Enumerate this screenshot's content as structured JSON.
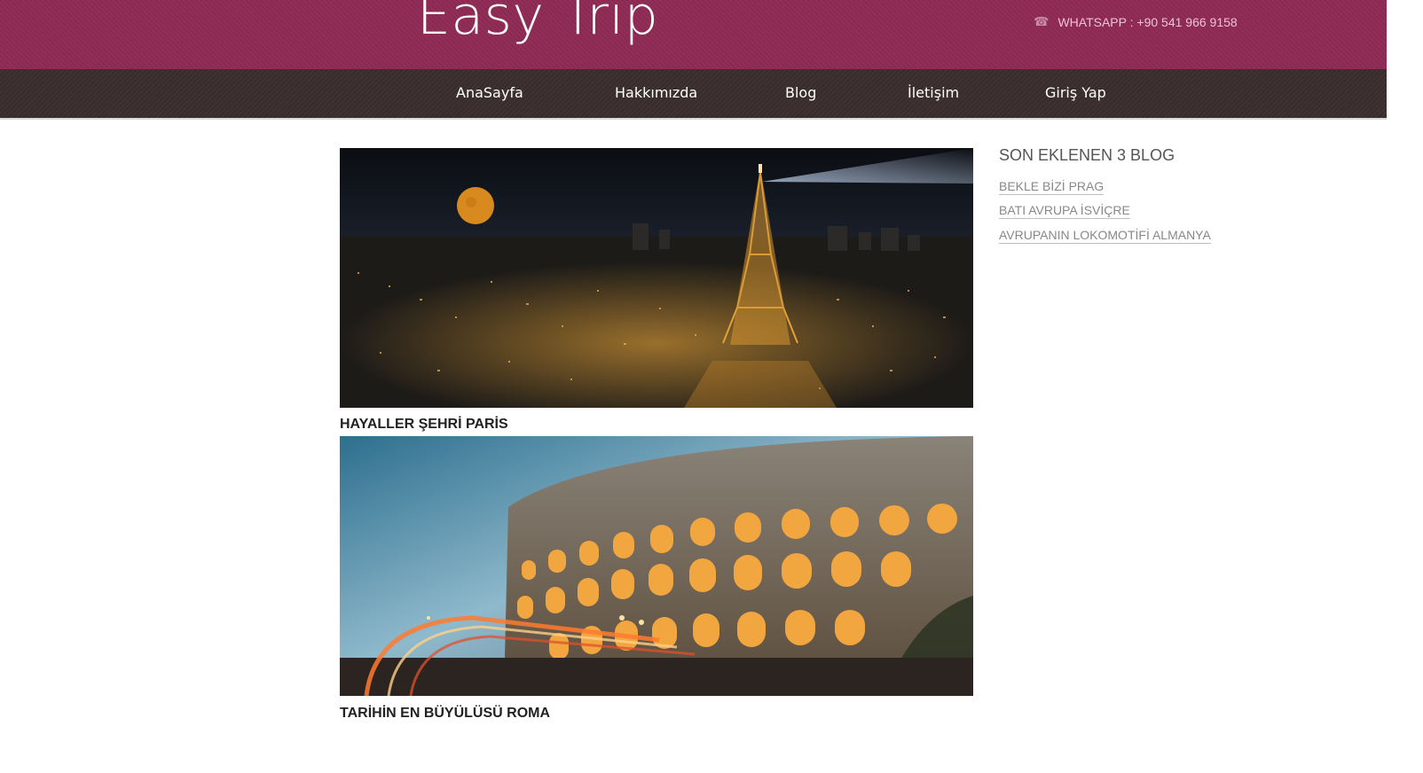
{
  "header": {
    "logo": "Easy Trip",
    "contact_icon": "phone-icon",
    "contact_text": "WHATSAPP : +90 541 966 9158",
    "background_color": "#8e2a55"
  },
  "nav": {
    "background_color": "#3a2c2c",
    "items": [
      {
        "label": "AnaSayfa"
      },
      {
        "label": "Hakkımızda"
      },
      {
        "label": "Blog"
      },
      {
        "label": "İletişim"
      },
      {
        "label": "Giriş Yap"
      }
    ]
  },
  "posts": [
    {
      "title": "HAYALLER ŞEHRİ PARİS",
      "image": "paris-eiffel-tower-night"
    },
    {
      "title": "TARİHİN EN BÜYÜLÜSÜ ROMA",
      "image": "rome-colosseum-dusk"
    }
  ],
  "sidebar": {
    "title": "SON EKLENEN 3 BLOG",
    "links": [
      {
        "label": "BEKLE BİZİ PRAG"
      },
      {
        "label": "BATI AVRUPA İSVİÇRE"
      },
      {
        "label": "AVRUPANIN LOKOMOTİFİ ALMANYA"
      }
    ]
  }
}
